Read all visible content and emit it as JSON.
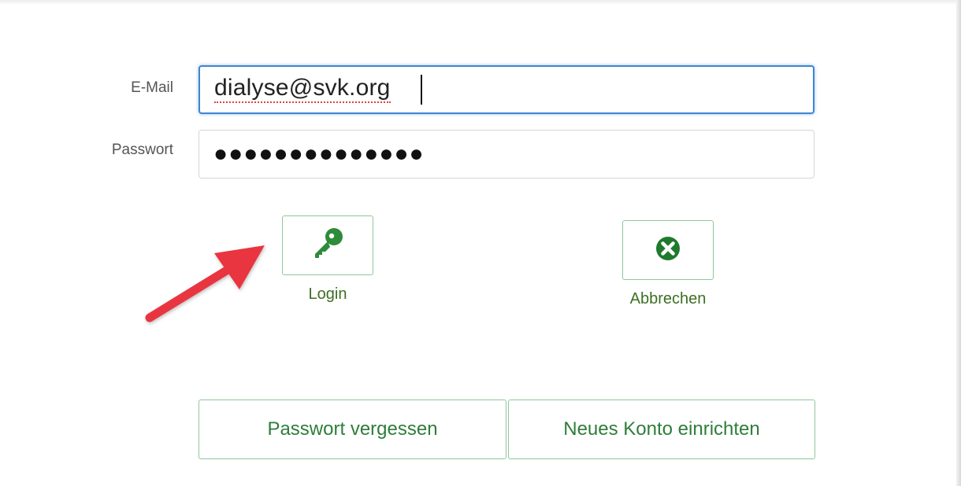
{
  "form": {
    "email_label": "E-Mail",
    "email_value": "dialyse@svk.org",
    "password_label": "Passwort",
    "password_masked": "●●●●●●●●●●●●●●"
  },
  "actions": {
    "login_label": "Login",
    "login_icon": "key-icon",
    "cancel_label": "Abbrechen",
    "cancel_icon": "close-circle-icon",
    "forgot_password_label": "Passwort vergessen",
    "new_account_label": "Neues Konto einrichten"
  },
  "colors": {
    "accent_green": "#2e7d3a",
    "button_border": "#8fc79a",
    "focus_blue": "#3d86d2",
    "annotation_arrow": "#e8363f"
  },
  "annotation": {
    "type": "arrow",
    "points_to": "login-button"
  }
}
